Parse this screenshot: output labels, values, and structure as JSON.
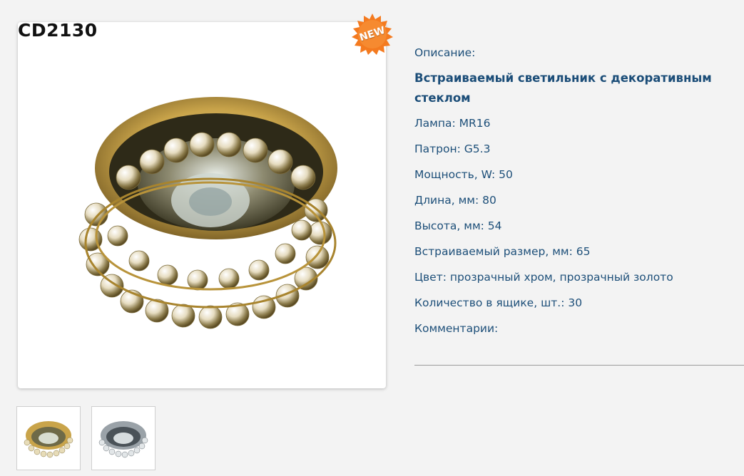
{
  "product": {
    "code": "CD2130",
    "badge": "NEW"
  },
  "specs": {
    "description_label": "Описание:",
    "title": "Встраиваемый светильник с декоративным стеклом",
    "lamp": "Лампа: MR16",
    "socket": "Патрон: G5.3",
    "power": "Мощность, W: 50",
    "length": "Длина, мм: 80",
    "height": "Высота, мм: 54",
    "cutout": "Встраиваемый размер, мм: 65",
    "color": "Цвет: прозрачный хром, прозрачный золото",
    "box_qty": "Количество в ящике, шт.: 30",
    "comments": "Комментарии:"
  },
  "thumbnails": [
    {
      "variant": "gold"
    },
    {
      "variant": "chrome"
    }
  ],
  "colors": {
    "badge": "#f47a1f",
    "spec_text": "#1d4f79",
    "gold": "#c9a44a",
    "chrome": "#8d959c"
  }
}
